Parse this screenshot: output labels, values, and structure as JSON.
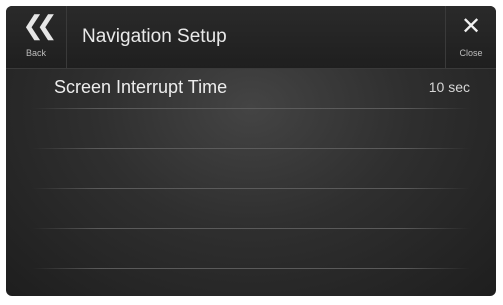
{
  "header": {
    "title": "Navigation Setup",
    "back": {
      "icon": "double-chevron-left-icon",
      "label": "Back"
    },
    "close": {
      "icon": "close-icon",
      "label": "Close"
    }
  },
  "settings": [
    {
      "label": "Screen Interrupt Time",
      "value": "10 sec"
    }
  ]
}
